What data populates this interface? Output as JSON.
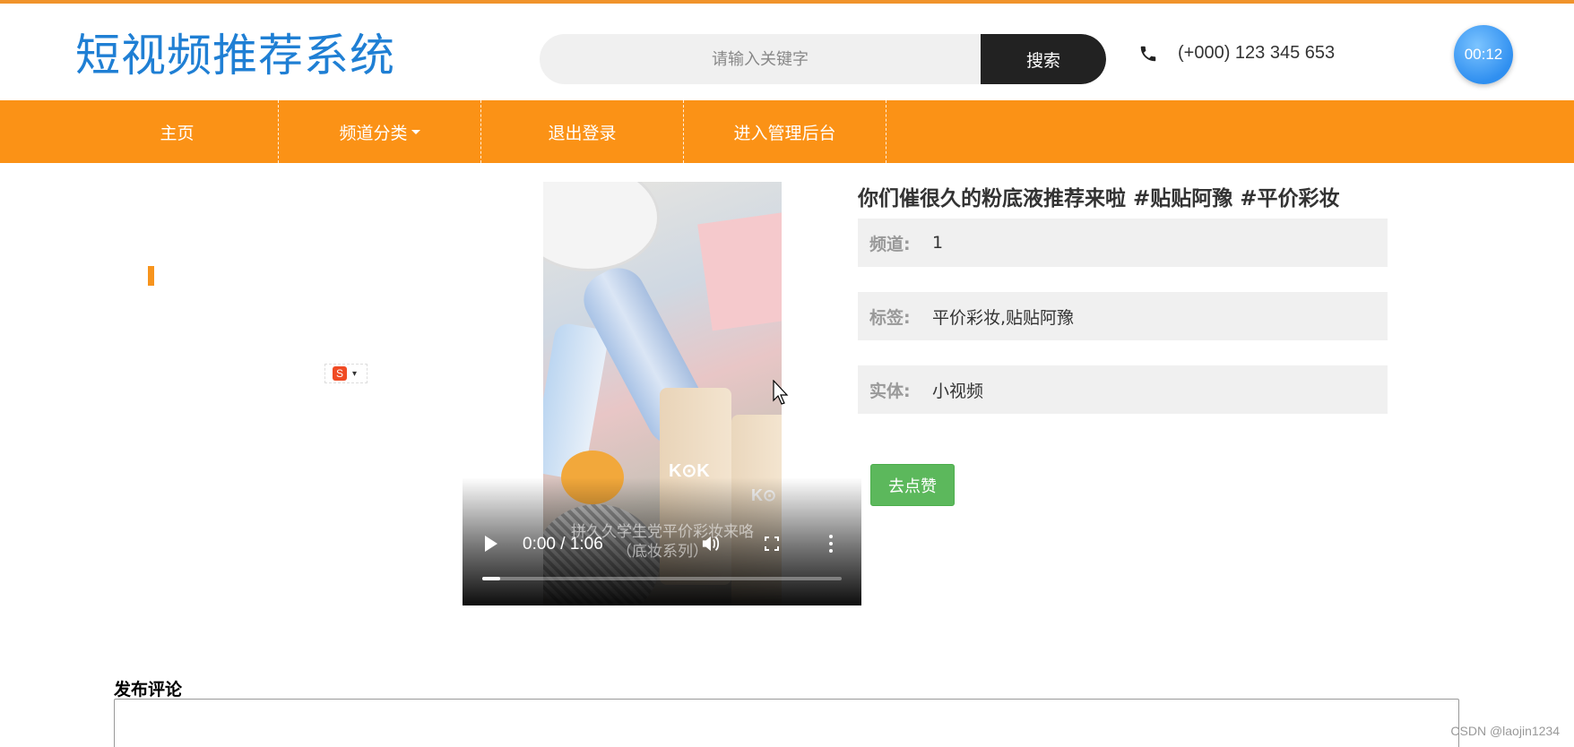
{
  "header": {
    "site_title": "短视频推荐系统",
    "search": {
      "placeholder": "请输入关键字",
      "value": "",
      "button_label": "搜索"
    },
    "phone": "(+000) 123 345 653",
    "timer": "00:12"
  },
  "nav": {
    "items": [
      {
        "label": "主页"
      },
      {
        "label": "频道分类",
        "has_dropdown": true
      },
      {
        "label": "退出登录"
      },
      {
        "label": "进入管理后台"
      }
    ]
  },
  "ime": {
    "icon_letter": "S"
  },
  "video": {
    "caption_line1": "拼久久学生党平价彩妆来咯",
    "caption_line2": "（底妆系列）",
    "time": "0:00 / 1:06",
    "progress": 0.05,
    "overlay_text_1": "K⊙K",
    "overlay_text_2": "K⊙"
  },
  "detail": {
    "title": "你们催很久的粉底液推荐来啦 #贴贴阿豫 #平价彩妆",
    "fields": [
      {
        "label": "频道:",
        "value": "1"
      },
      {
        "label": "标签:",
        "value": "平价彩妆,贴贴阿豫"
      },
      {
        "label": "实体:",
        "value": "小视频"
      }
    ],
    "like_button": "去点赞"
  },
  "comment": {
    "title": "发布评论",
    "value": ""
  },
  "watermark": "CSDN @laojin1234",
  "colors": {
    "brand_blue": "#1f7fd4",
    "nav_orange": "#fb9216",
    "like_green": "#5cb85c"
  }
}
